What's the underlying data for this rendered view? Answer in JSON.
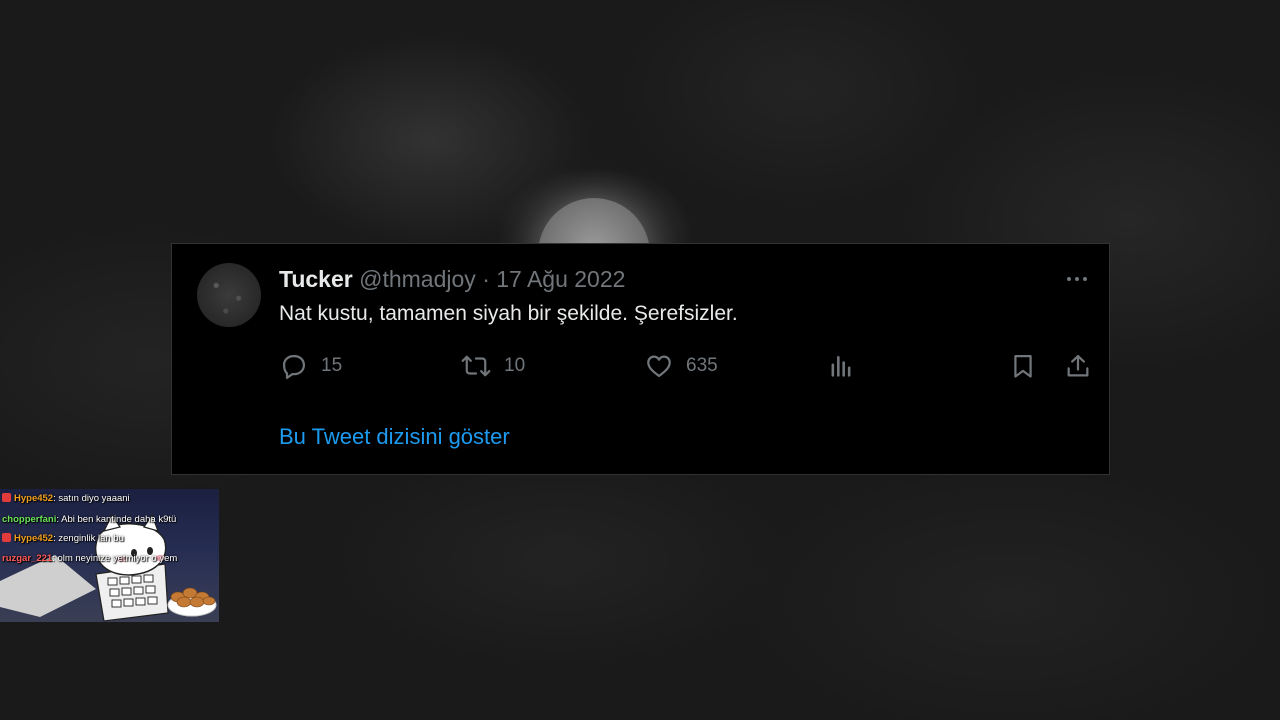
{
  "tweet": {
    "display_name": "Tucker",
    "handle": "@thmadjoy",
    "separator": "·",
    "date": "17 Ağu 2022",
    "text": "Nat kustu, tamamen siyah bir şekilde. Şerefsizler.",
    "actions": {
      "replies": "15",
      "retweets": "10",
      "likes": "635"
    },
    "show_thread_label": "Bu Tweet dizisini göster"
  },
  "stream_overlay": {
    "chat": [
      {
        "user": "Hype452",
        "message": ": satın diyo yaaani",
        "color": "#f0a020",
        "badge": true
      },
      {
        "user": "chopperfani",
        "message": ": Abi ben kantinde daha k9tü",
        "color": "#6be35a",
        "badge": false
      },
      {
        "user": "Hype452",
        "message": ": zenginlik lan bu",
        "color": "#f0a020",
        "badge": true
      },
      {
        "user": "ruzgar_221",
        "message": ": olm neyinize yetmiyor o yem",
        "color": "#ff5a5a",
        "badge": false
      }
    ]
  },
  "colors": {
    "background": "#1a1a1a",
    "card": "#000000",
    "text_primary": "#e7e9ea",
    "text_secondary": "#71767b",
    "link": "#1d9bf0"
  },
  "icons": [
    "reply-icon",
    "retweet-icon",
    "like-icon",
    "views-icon",
    "bookmark-icon",
    "share-icon",
    "more-icon"
  ]
}
